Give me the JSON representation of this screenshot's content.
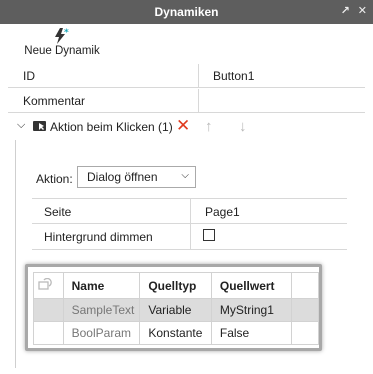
{
  "window": {
    "title": "Dynamiken",
    "btn_popout": "↗",
    "btn_close": "✕"
  },
  "toolbar": {
    "new_dynamic_label": "Neue Dynamik"
  },
  "properties": [
    {
      "key": "ID",
      "value": "Button1"
    },
    {
      "key": "Kommentar",
      "value": ""
    }
  ],
  "action_section": {
    "title": "Aktion beim Klicken (1)",
    "aktion_label": "Aktion:",
    "aktion_value": "Dialog öffnen",
    "rows": [
      {
        "key": "Seite",
        "value": "Page1"
      },
      {
        "key": "Hintergrund dimmen",
        "checked": false
      }
    ],
    "params_table": {
      "columns": [
        "Name",
        "Quelltyp",
        "Quellwert"
      ],
      "rows": [
        {
          "name": "SampleText",
          "type": "Variable",
          "value": "MyString1"
        },
        {
          "name": "BoolParam",
          "type": "Konstante",
          "value": "False"
        }
      ]
    }
  },
  "colors": {
    "titlebar": "#5e5e5e",
    "delete": "#e03a1e",
    "selected_row": "#dcdcdc"
  }
}
